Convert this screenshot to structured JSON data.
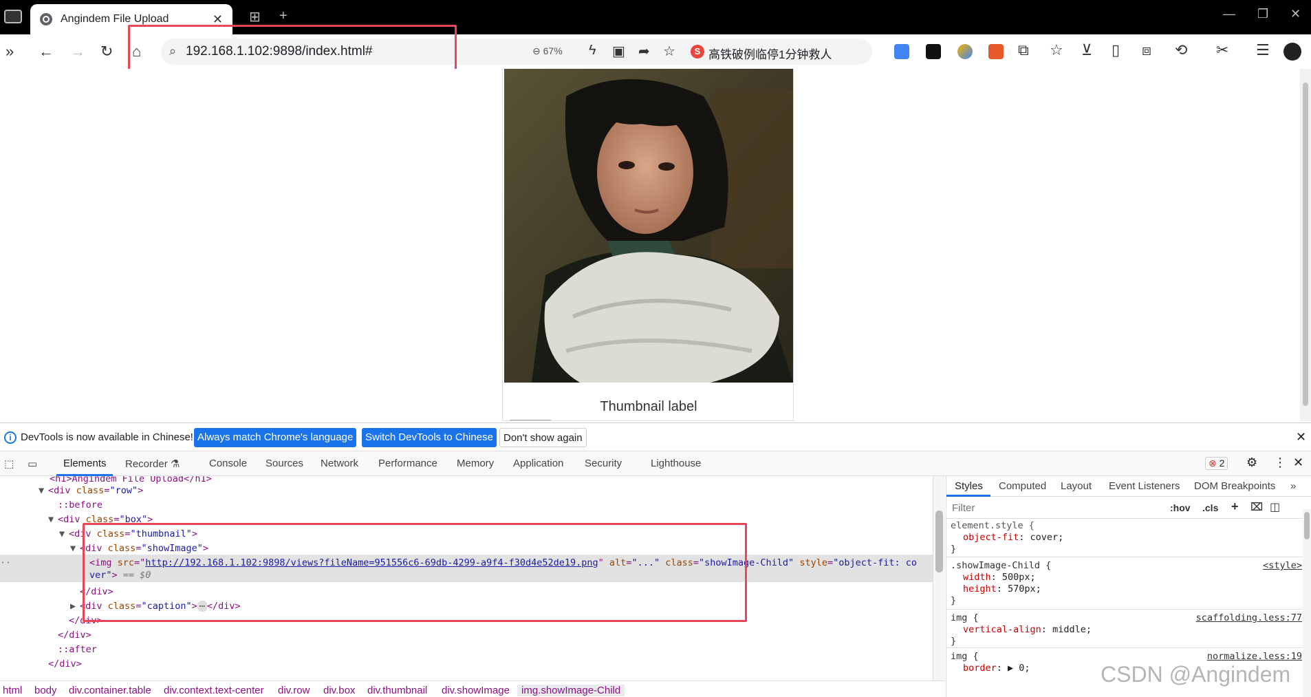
{
  "tab": {
    "title": "Angindem File Upload",
    "close": "✕",
    "new_tab": "+"
  },
  "window": {
    "minimize": "—",
    "restore": "❐",
    "close": "✕"
  },
  "omnibox": {
    "url": "192.168.1.102:9898/index.html#",
    "zoom": "67%",
    "news_text": "高铁破例临停1分钟救人",
    "s_badge": "S"
  },
  "page": {
    "caption": "Thumbnail label"
  },
  "infobar": {
    "message": "DevTools is now available in Chinese!",
    "btn_match": "Always match Chrome's language",
    "btn_switch": "Switch DevTools to Chinese",
    "btn_dismiss": "Don't show again",
    "close": "✕"
  },
  "devtools": {
    "tabs": [
      "Elements",
      "Recorder ⚗",
      "Console",
      "Sources",
      "Network",
      "Performance",
      "Memory",
      "Application",
      "Security",
      "Lighthouse"
    ],
    "error_count": "2",
    "dom": {
      "l0": "<h1>Angindem File Upload</h1>",
      "l1_tag": "div",
      "l1_attr": "class",
      "l1_val": "\"row\"",
      "l2": "::before",
      "l3_tag": "div",
      "l3_attr": "class",
      "l3_val": "\"box\"",
      "l4_tag": "div",
      "l4_attr": "class",
      "l4_val": "\"thumbnail\"",
      "l5_tag": "div",
      "l5_attr": "class",
      "l5_val": "\"showImage\"",
      "img_src_label": "src",
      "img_src": "http://192.168.1.102:9898/views?fileName=951556c6-69db-4299-a9f4-f30d4e52de19.png",
      "img_alt_label": "alt",
      "img_alt": "\"...\"",
      "img_class_label": "class",
      "img_class": "\"showImage-Child\"",
      "img_style_label": "style",
      "img_style_a": "\"object-fit: co",
      "img_style_b": "ver\"",
      "img_eq": "== $0",
      "close_div": "</div>",
      "l8_tag": "div",
      "l8_attr": "class",
      "l8_val": "\"caption\"",
      "ellipsis": "⋯",
      "after": "::after"
    },
    "breadcrumbs": [
      "html",
      "body",
      "div.container.table",
      "div.context.text-center",
      "div.row",
      "div.box",
      "div.thumbnail",
      "div.showImage",
      "img.showImage-Child"
    ],
    "styles_tabs": [
      "Styles",
      "Computed",
      "Layout",
      "Event Listeners",
      "DOM Breakpoints"
    ],
    "filter_placeholder": "Filter",
    "hov": ":hov",
    "cls": ".cls",
    "rules": {
      "r1_sel": "element.style {",
      "r1_p1n": "object-fit",
      "r1_p1v": "cover;",
      "r2_sel": ".showImage-Child {",
      "r2_src": "<style>",
      "r2_p1n": "width",
      "r2_p1v": "500px;",
      "r2_p2n": "height",
      "r2_p2v": "570px;",
      "r3_sel": "img {",
      "r3_src": "scaffolding.less:77",
      "r3_p1n": "vertical-align",
      "r3_p1v": "middle;",
      "r4_sel": "img {",
      "r4_src": "normalize.less:19",
      "r4_p1n": "border",
      "r4_p1v": "▶ 0;",
      "brace_close": "}"
    }
  },
  "watermark": "CSDN @Angindem"
}
